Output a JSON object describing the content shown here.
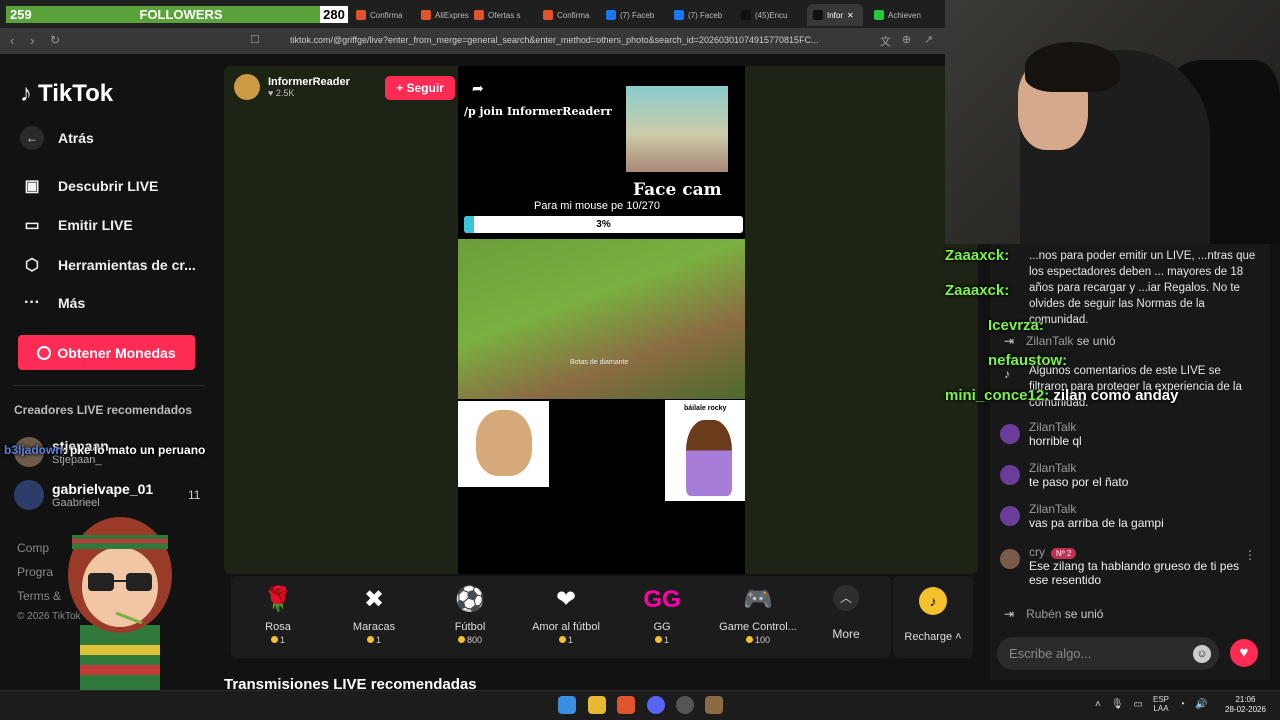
{
  "overlay": {
    "followers_current": "259",
    "followers_label": "FOLLOWERS",
    "followers_goal": "280"
  },
  "browser": {
    "tabs": [
      {
        "label": "Confirma"
      },
      {
        "label": "AliExpres"
      },
      {
        "label": "Ofertas s"
      },
      {
        "label": "Confirma"
      },
      {
        "label": "(7) Faceb"
      },
      {
        "label": "(7) Faceb"
      },
      {
        "label": "(45)Encu"
      },
      {
        "label": "Infor"
      },
      {
        "label": "Achieven"
      }
    ],
    "url": "tiktok.com/@griffge/live?enter_from_merge=general_search&enter_method=others_photo&search_id=20260301074915770815FC..."
  },
  "sidebar": {
    "logo": "TikTok",
    "back": "Atrás",
    "discover": "Descubrir LIVE",
    "broadcast": "Emitir LIVE",
    "tools": "Herramientas de cr...",
    "more": "Más",
    "coins_button": "Obtener Monedas",
    "recommended_label": "Creadores LIVE recomendados",
    "creators": [
      {
        "name": "stjepaan",
        "sub": "Stjepaan_"
      },
      {
        "name": "gabrielvape_01",
        "sub": "Gaabrieel",
        "count": "11"
      }
    ],
    "footer": [
      "Comp",
      "Progra",
      "Terms &",
      "© 2026 TikTok"
    ]
  },
  "live": {
    "host_name": "InformerReader",
    "host_likes": "2.5K",
    "follow_button": "+ Seguir",
    "join_text": "/p join InformerReaderr",
    "facecam_text": "Face cam",
    "goal_text": "Para mi mouse pe  10/270",
    "goal_percent": "3%",
    "goal_fraction": 0.037,
    "game_caption": "Botas de diamante",
    "sticker_text": "báilale rocky"
  },
  "gifts": [
    {
      "name": "Rosa",
      "price": "1",
      "icon": "rose-icon"
    },
    {
      "name": "Maracas",
      "price": "1",
      "icon": "maracas-icon"
    },
    {
      "name": "Fútbol",
      "price": "800",
      "icon": "football-icon"
    },
    {
      "name": "Amor al fútbol",
      "price": "1",
      "icon": "football-love-icon"
    },
    {
      "name": "GG",
      "price": "1",
      "icon": "gg-icon"
    },
    {
      "name": "Game Control...",
      "price": "100",
      "icon": "game-controller-icon"
    }
  ],
  "gifts_more": "More",
  "recharge": "Recharge",
  "recommended_streams": "Transmisiones LIVE recomendadas",
  "chat": {
    "system_note": "...nos para poder emitir un LIVE, ...ntras que los espectadores deben ... mayores de 18 años para recargar y ...iar Regalos. No te olvides de seguir las Normas de la comunidad.",
    "join1_user": "ZilanTalk",
    "join1_text": "se unió",
    "system_note2": "Algunos comentarios de este LIVE se filtraron para proteger la experiencia de la comunidad.",
    "messages": [
      {
        "user": "ZilanTalk",
        "text": "horrible ql"
      },
      {
        "user": "ZilanTalk",
        "text": "te paso por el ñato"
      },
      {
        "user": "ZilanTalk",
        "text": "vas pa arriba de la gampi"
      },
      {
        "user": "cry",
        "badge": "Nº 2",
        "text": "Ese zilang ta hablando grueso de ti pes ese resentido"
      }
    ],
    "join2_user": "Rubén",
    "join2_text": "se unió",
    "input_placeholder": "Escribe algo..."
  },
  "stream_overlay": [
    {
      "user": "Zaaaxck:",
      "text": ""
    },
    {
      "user": "Zaaaxck:",
      "text": ""
    },
    {
      "user": "Icevrza:",
      "text": ""
    },
    {
      "user": "nefaustow:",
      "text": ""
    },
    {
      "user": "mini_conce12:",
      "text": "zilan como anday"
    },
    {
      "user": "b3ljadown",
      "text": ": pke lo mato un peruano"
    }
  ],
  "taskbar": {
    "lang1": "ESP",
    "lang2": "LAA",
    "time": "21:06",
    "date": "28-02-2026"
  }
}
